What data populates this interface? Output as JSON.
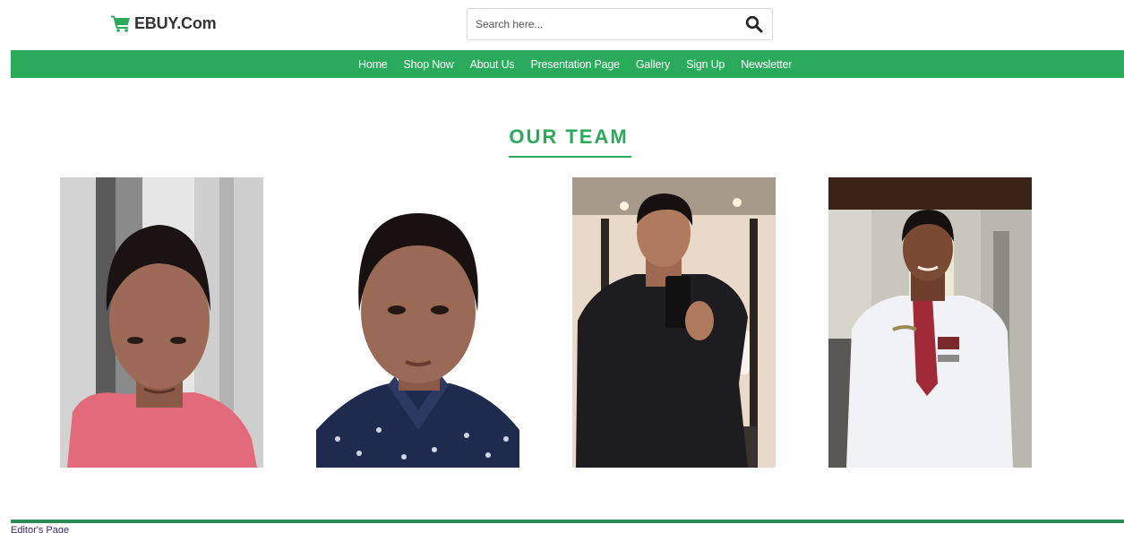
{
  "header": {
    "logo_text": "EBUY.Com",
    "logo_icon": "shopping-cart-icon",
    "search": {
      "placeholder": "Search here...",
      "value": "",
      "button_icon": "search-icon"
    }
  },
  "nav": {
    "items": [
      {
        "label": "Home"
      },
      {
        "label": "Shop Now"
      },
      {
        "label": "About Us"
      },
      {
        "label": "Presentation Page"
      },
      {
        "label": "Gallery"
      },
      {
        "label": "Sign Up"
      },
      {
        "label": "Newsletter"
      }
    ]
  },
  "team": {
    "title": "OUR TEAM",
    "members": [
      {
        "photo": "team-member-photo"
      },
      {
        "photo": "team-member-photo"
      },
      {
        "photo": "team-member-photo"
      },
      {
        "photo": "team-member-photo"
      }
    ]
  },
  "footer": {
    "link_text": "Editor's Page"
  },
  "colors": {
    "brand_green": "#2aab5b",
    "footer_green": "#2e8b57",
    "logo_text": "#333333",
    "footer_link": "#3b2a6e"
  }
}
